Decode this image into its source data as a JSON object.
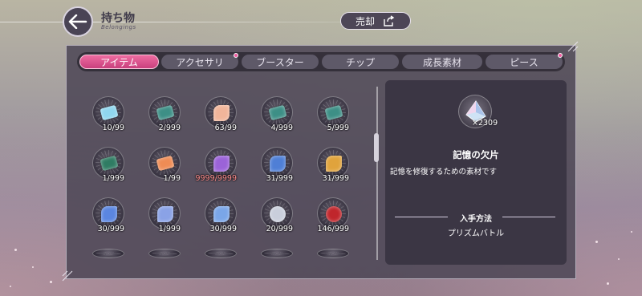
{
  "header": {
    "title": "持ち物",
    "subtitle": "Belongings",
    "sell_label": "売却"
  },
  "tabs": [
    {
      "label": "アイテム",
      "active": true
    },
    {
      "label": "アクセサリ",
      "active": false,
      "badge": true
    },
    {
      "label": "ブースター",
      "active": false
    },
    {
      "label": "チップ",
      "active": false
    },
    {
      "label": "成長素材",
      "active": false
    },
    {
      "label": "ピース",
      "active": false,
      "badge": true
    }
  ],
  "items": [
    {
      "count": "10/99",
      "icon": "blue-ticket-icon",
      "color": "#8fd6ee"
    },
    {
      "count": "2/999",
      "icon": "teal-ticket-icon",
      "color": "#3d8f86"
    },
    {
      "count": "63/99",
      "icon": "peach-crystal-icon",
      "color": "#f1b59a"
    },
    {
      "count": "4/999",
      "icon": "teal-ticket-icon",
      "color": "#3d8f86"
    },
    {
      "count": "5/999",
      "icon": "teal-ticket-icon",
      "color": "#3d8f86"
    },
    {
      "count": "1/999",
      "icon": "green-ticket-icon",
      "color": "#2f7c63"
    },
    {
      "count": "1/99",
      "icon": "orange-ticket-icon",
      "color": "#ef8c55"
    },
    {
      "count": "9999/9999",
      "icon": "purple-crystal-icon",
      "color": "#9b63d8",
      "max": true
    },
    {
      "count": "31/999",
      "icon": "blue-charm-icon",
      "color": "#4f7fd6"
    },
    {
      "count": "31/999",
      "icon": "gold-charm-icon",
      "color": "#e0a33c"
    },
    {
      "count": "30/999",
      "icon": "blue-bell-icon",
      "color": "#5b86e0"
    },
    {
      "count": "1/999",
      "icon": "potion-bottle-icon",
      "color": "#8aa2e6"
    },
    {
      "count": "30/999",
      "icon": "blue-gem-icon",
      "color": "#7aa6e8"
    },
    {
      "count": "20/999",
      "icon": "silver-cluster-icon",
      "color": "#c9cedb"
    },
    {
      "count": "146/999",
      "icon": "red-orb-icon",
      "color": "#c0262c"
    },
    {
      "count": "",
      "icon": "navy-orb-icon",
      "color": "#2b3a6c"
    },
    {
      "count": "",
      "icon": "amber-orb-icon",
      "color": "#d58a22"
    },
    {
      "count": "",
      "icon": "white-orb-icon",
      "color": "#d9d9e2"
    },
    {
      "count": "",
      "icon": "black-orb-icon",
      "color": "#2a2a36"
    },
    {
      "count": "",
      "icon": "silver-flower-icon",
      "color": "#c7c4cf"
    }
  ],
  "detail": {
    "icon": "memory-shard-icon",
    "count": "×2309",
    "name": "記憶の欠片",
    "description": "記憶を修復するための素材です",
    "acquire_title": "入手方法",
    "acquire_value": "プリズムバトル"
  },
  "colors": {
    "accent": "#e2558f",
    "panel": "#4e4856",
    "max_count": "#ff8f8f"
  }
}
